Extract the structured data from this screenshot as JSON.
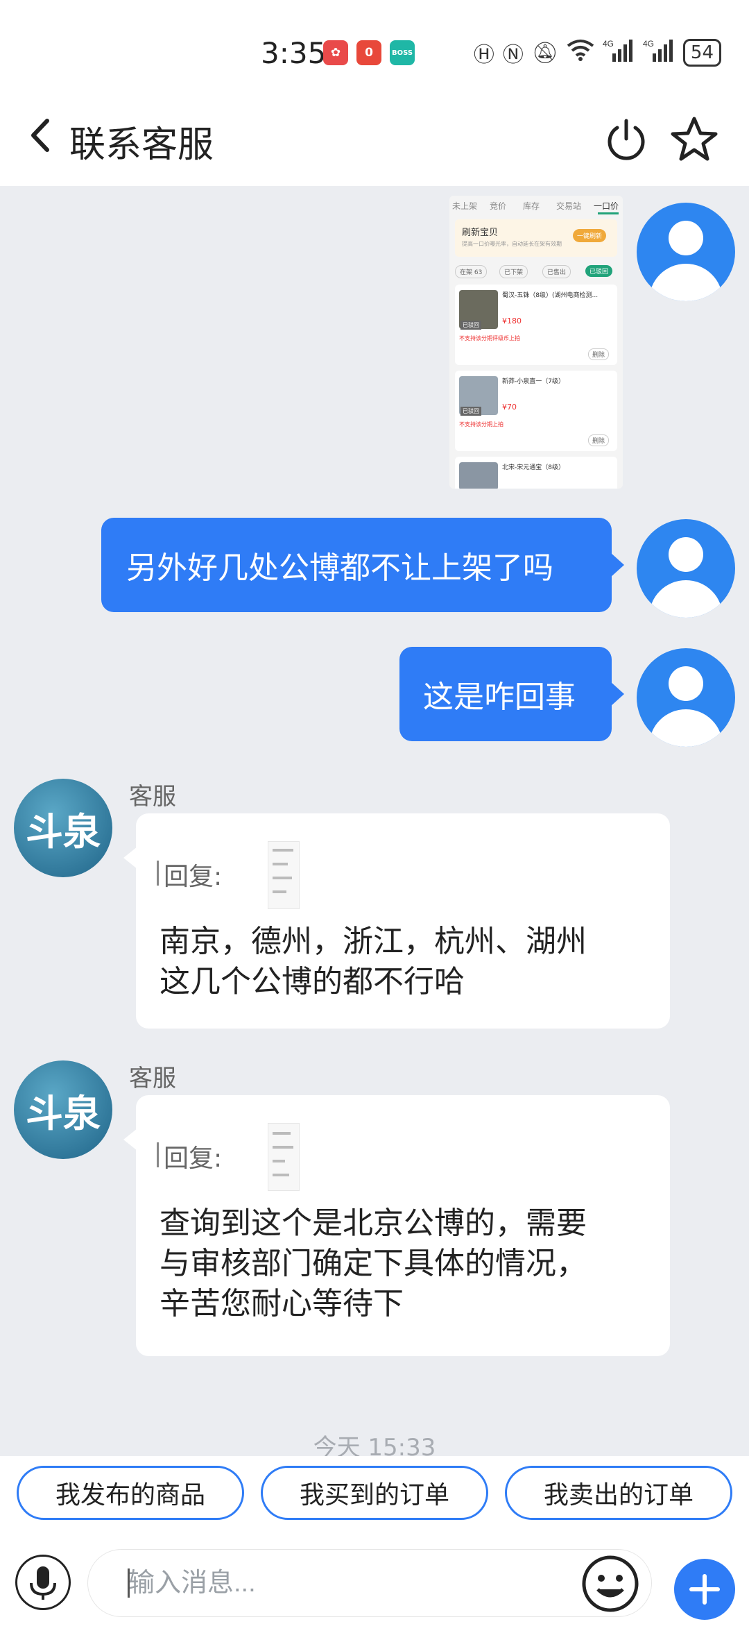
{
  "status_bar": {
    "time": "3:35",
    "app_badges": [
      {
        "icon": "game-app-icon",
        "text": "",
        "color": "#e94a4a"
      },
      {
        "icon": "notification-app-icon",
        "text": "0",
        "color": "#e8483a"
      },
      {
        "icon": "boss-app-icon",
        "text": "BOSS",
        "color": "#1fb7a6"
      }
    ],
    "battery": "54"
  },
  "header": {
    "title": "联系客服",
    "back_icon": "chevron-left-icon",
    "power_icon": "power-icon",
    "star_icon": "star-outline-icon"
  },
  "screenshot_thumb": {
    "tabs": [
      "未上架",
      "竞价",
      "库存",
      "交易站",
      "一口价"
    ],
    "banner_title": "刷新宝贝",
    "banner_sub": "提高一口价曝光率，自动延长在架有效期",
    "banner_btn": "一键刷新",
    "filters": [
      "在架 63",
      "已下架",
      "已售出",
      "已驳回"
    ],
    "items": [
      {
        "name": "蜀汉-五铢（8级）(湖州电商检测...",
        "price": "¥180",
        "tag": "已驳回",
        "note": "不支持该分期评级币上拍",
        "action": "删除"
      },
      {
        "name": "新莽-小泉直一（7级）",
        "price": "¥70",
        "tag": "已驳回",
        "note": "不支持该分期上拍",
        "action": "删除"
      },
      {
        "name": "北宋-宋元通宝（8级）",
        "price": "",
        "tag": "",
        "note": "",
        "action": ""
      }
    ]
  },
  "messages": {
    "me_1": "另外好几处公博都不让上架了吗",
    "me_2": "这是咋回事",
    "svc_1": {
      "sender": "客服",
      "avatar_text": "斗泉",
      "reply_label": "回复:",
      "lines": [
        "南京，德州，浙江，杭州、湖州",
        "这几个公博的都不行哈"
      ]
    },
    "svc_2": {
      "sender": "客服",
      "avatar_text": "斗泉",
      "reply_label": "回复:",
      "lines": [
        "查询到这个是北京公博的，需要",
        "与审核部门确定下具体的情况，",
        "辛苦您耐心等待下"
      ]
    },
    "timestamp": "今天 15:33"
  },
  "quick_replies": [
    "我发布的商品",
    "我买到的订单",
    "我卖出的订单"
  ],
  "input": {
    "placeholder": "输入消息...",
    "mic_icon": "microphone-icon",
    "emoji_icon": "emoji-smile-icon",
    "plus_icon": "plus-icon"
  },
  "colors": {
    "accent": "#2f7cf6",
    "chat_bg": "#ebedf1",
    "service_avatar": "#2a7aa0"
  }
}
